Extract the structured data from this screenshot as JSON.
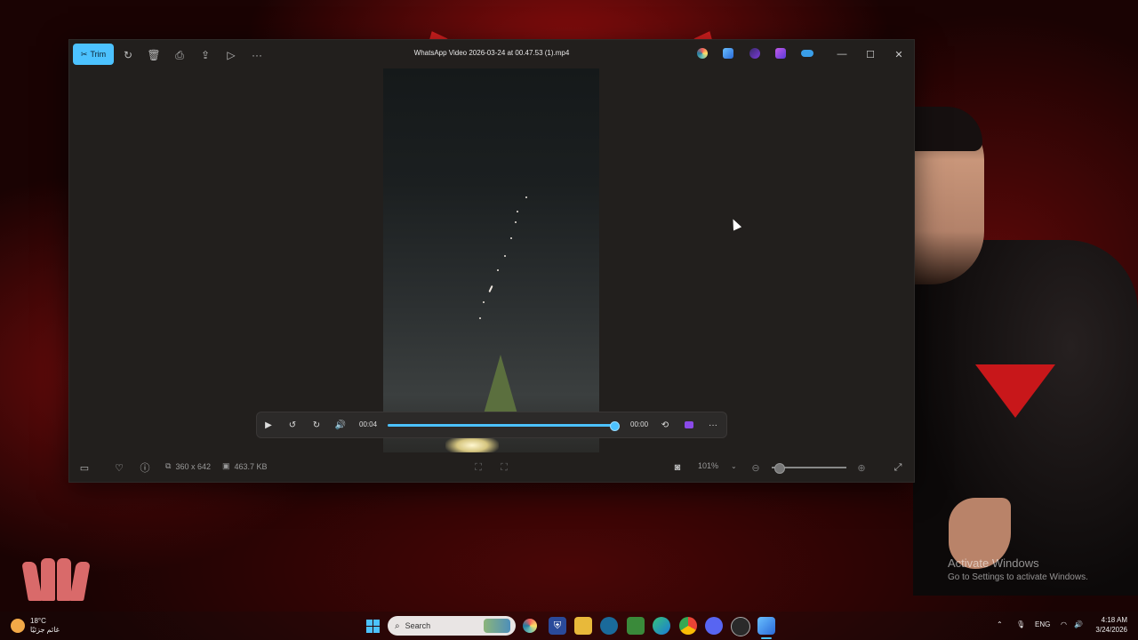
{
  "window": {
    "title": "WhatsApp Video 2026-03-24 at 00.47.53 (1).mp4",
    "toolbar": {
      "trim_label": "Trim",
      "icons": [
        "trim-icon",
        "rotate-icon",
        "delete-icon",
        "print-icon",
        "share-icon",
        "slideshow-icon",
        "more-icon"
      ]
    },
    "app_icons": [
      "copilot-icon",
      "photos-edit-icon",
      "clipchamp-icon",
      "designer-icon",
      "onedrive-icon"
    ],
    "controls": {
      "minimize": "—",
      "maximize": "☐",
      "close": "✕"
    }
  },
  "player": {
    "current_time": "00:04",
    "total_time": "00:00",
    "progress": 1.0,
    "icons": [
      "play-icon",
      "rewind-10-icon",
      "forward-30-icon",
      "volume-icon",
      "loop-off-icon",
      "clipchamp-icon",
      "more-icon"
    ]
  },
  "bottombar": {
    "dimensions": "360 x 642",
    "file_size": "463.7 KB",
    "zoom": "101%",
    "zoom_level": 0.1
  },
  "desktop": {
    "activate_title": "Activate Windows",
    "activate_sub": "Go to Settings to activate Windows."
  },
  "taskbar": {
    "temperature": "18°C",
    "weather_text": "غائم جزئيًا",
    "search_label": "Search",
    "language": "ENG",
    "time": "4:18 AM",
    "date": "3/24/2026",
    "apps": [
      "start-icon",
      "copilot-app-icon",
      "shield-app-icon",
      "file-explorer-icon",
      "app-icon",
      "minecraft-icon",
      "edge-icon",
      "chrome-icon",
      "discord-icon",
      "steam-icon",
      "photos-app-icon"
    ]
  },
  "colors": {
    "accent": "#4cc2ff",
    "window_bg": "#221f1d",
    "desktop_red": "#8a0d0d"
  }
}
